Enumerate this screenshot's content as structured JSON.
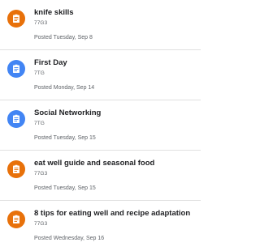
{
  "colors": {
    "orange": "#e8710a",
    "blue": "#4285f4"
  },
  "posts": [
    {
      "title": "knife skills",
      "class_name": "77G3",
      "posted": "Posted Tuesday, Sep 8",
      "icon": "assignment-icon",
      "icon_color": "#e8710a"
    },
    {
      "title": "First Day",
      "class_name": "7TG",
      "posted": "Posted Monday, Sep 14",
      "icon": "assignment-icon",
      "icon_color": "#4285f4"
    },
    {
      "title": "Social Networking",
      "class_name": "7TG",
      "posted": "Posted Tuesday, Sep 15",
      "icon": "assignment-icon",
      "icon_color": "#4285f4"
    },
    {
      "title": "eat well guide and seasonal food",
      "class_name": "77G3",
      "posted": "Posted Tuesday, Sep 15",
      "icon": "assignment-icon",
      "icon_color": "#e8710a"
    },
    {
      "title": "8 tips for eating well and recipe adaptation",
      "class_name": "77G3",
      "posted": "Posted Wednesday, Sep 16",
      "icon": "assignment-icon",
      "icon_color": "#e8710a"
    }
  ]
}
